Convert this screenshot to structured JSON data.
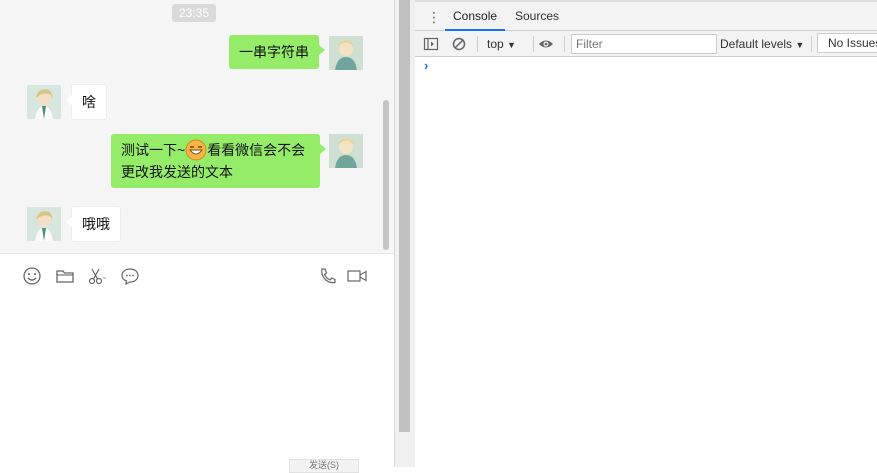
{
  "chat": {
    "timestamp": "23:35",
    "messages": [
      {
        "direction": "out",
        "text": "一串字符串"
      },
      {
        "direction": "in",
        "text": "啥"
      },
      {
        "direction": "out",
        "text_before_emoji": "测试一下~",
        "emoji": "grinning-emoji",
        "text_after_emoji": "看看微信会不会",
        "text_line2": "更改我发送的文本"
      },
      {
        "direction": "in",
        "text": "哦哦"
      }
    ],
    "toolbar_icons": [
      "emoji-icon",
      "folder-icon",
      "scissors-icon",
      "chat-bubble-icon",
      "phone-icon",
      "video-icon"
    ],
    "send_button_label": "发送(S)"
  },
  "devtools": {
    "tabs": [
      {
        "label": "Console",
        "active": true
      },
      {
        "label": "Sources",
        "active": false
      }
    ],
    "context": "top",
    "filter_placeholder": "Filter",
    "levels": "Default levels",
    "issues": "No Issues",
    "prompt_symbol": "›",
    "accent": "#1a73e8"
  },
  "colors": {
    "outgoing_bubble": "#95ec69",
    "incoming_bubble": "#ffffff",
    "chat_background": "#f5f5f5"
  }
}
